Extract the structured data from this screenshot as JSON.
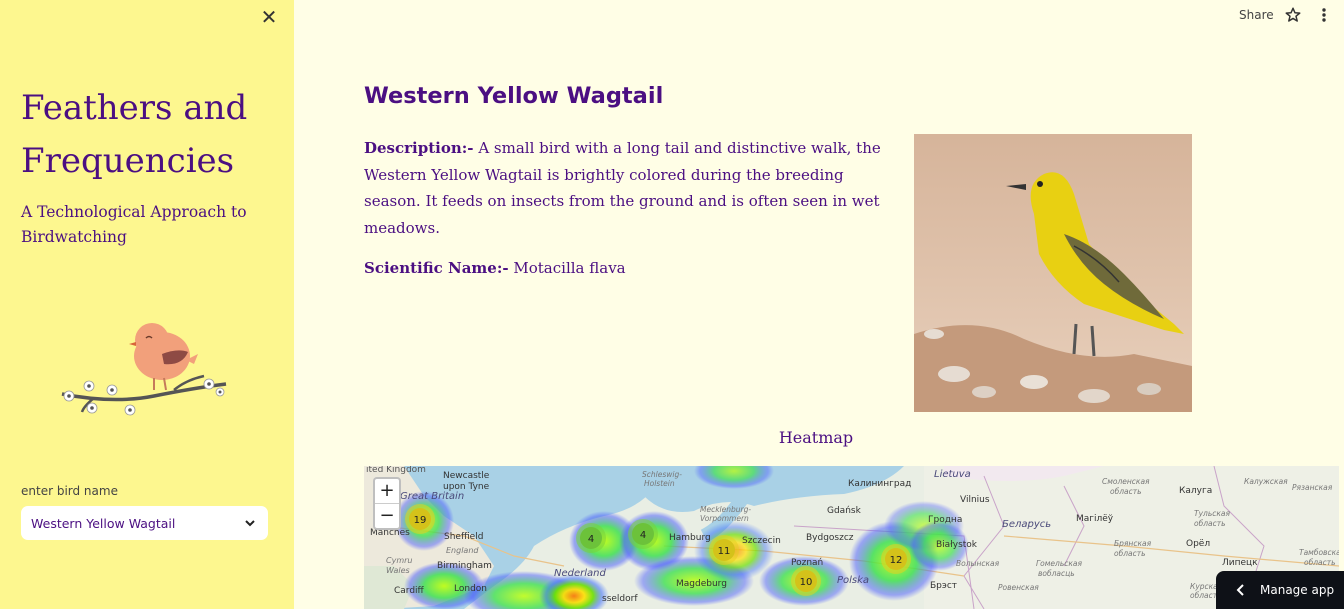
{
  "sidebar": {
    "close_glyph": "✕",
    "title": "Feathers and Frequencies",
    "subtitle": "A Technological Approach to Birdwatching",
    "select_label": "enter bird name",
    "select_value": "Western Yellow Wagtail"
  },
  "topbar": {
    "share_label": "Share"
  },
  "main": {
    "bird_name": "Western Yellow Wagtail",
    "description_label": "Description:-",
    "description": "A small bird with a long tail and distinctive walk, the Western Yellow Wagtail is brightly colored during the breeding season. It feeds on insects from the ground and is often seen in wet meadows.",
    "scientific_label": "Scientific Name:-",
    "scientific_name": "Motacilla flava",
    "heatmap_title": "Heatmap"
  },
  "map": {
    "zoom_in": "+",
    "zoom_out": "−",
    "places": [
      "ited Kingdom",
      "Newcastle upon Tyne",
      "Great Britain",
      "Manches",
      "Sheffield",
      "England",
      "Birmingham",
      "Cymru Wales",
      "Cardiff",
      "London",
      "Nederland",
      "Schleswig-Holstein",
      "Hamburg",
      "Mecklenburg-Vorpommern",
      "Szczecin",
      "Magdeburg",
      "sseldorf",
      "Gdańsk",
      "Калининград",
      "Bydgoszcz",
      "Poznań",
      "Polska",
      "Lietuva",
      "Vilnius",
      "Гродна",
      "Białystok",
      "Брэст",
      "Беларусь",
      "Магілёў",
      "Смоленская область",
      "Калуга",
      "Орёл",
      "Липецк",
      "Курская область",
      "Тамбовская область",
      "Брянская область",
      "Гомельская вобласць",
      "Ровенская область",
      "Волынская область",
      "Калужская область",
      "Рязанская область"
    ],
    "clusters": [
      "19",
      "4",
      "4",
      "11",
      "10",
      "12"
    ]
  },
  "manage_app": {
    "label": "Manage app"
  },
  "colors": {
    "accent": "#4b0f82",
    "sidebar_bg": "#fdf78f",
    "page_bg": "#fffee6"
  }
}
